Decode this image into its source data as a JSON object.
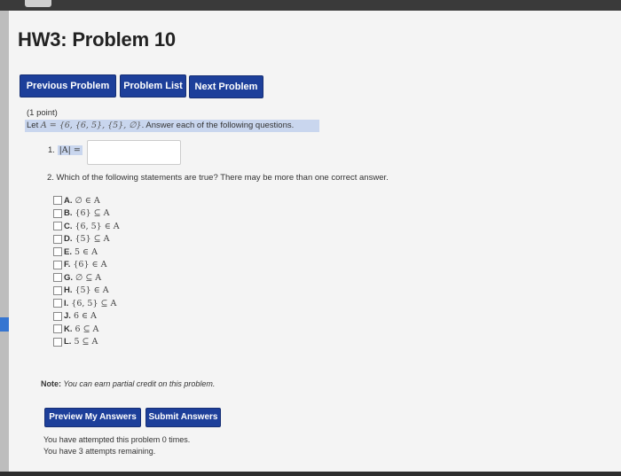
{
  "page_title": "HW3: Problem 10",
  "nav": {
    "prev": "Previous Problem",
    "list": "Problem List",
    "next": "Next Problem"
  },
  "problem": {
    "points": "(1 point)",
    "intro_prefix": "Let ",
    "intro_set": "A = {6, {6, 5}, {5}, ∅}",
    "intro_suffix": ". Answer each of the following questions."
  },
  "q1": {
    "number": "1.",
    "label": "|A| =",
    "value": ""
  },
  "q2": {
    "text": "2. Which of the following statements are true? There may be more than one correct answer."
  },
  "options": [
    {
      "letter": "A.",
      "stmt": "∅ ∈ A"
    },
    {
      "letter": "B.",
      "stmt": "{6} ⊆ A"
    },
    {
      "letter": "C.",
      "stmt": "{6, 5} ∈ A"
    },
    {
      "letter": "D.",
      "stmt": "{5} ⊆ A"
    },
    {
      "letter": "E.",
      "stmt": "5 ∈ A"
    },
    {
      "letter": "F.",
      "stmt": "{6} ∈ A"
    },
    {
      "letter": "G.",
      "stmt": "∅ ⊆ A"
    },
    {
      "letter": "H.",
      "stmt": "{5} ∈ A"
    },
    {
      "letter": "I.",
      "stmt": "{6, 5} ⊆ A"
    },
    {
      "letter": "J.",
      "stmt": "6 ∈ A"
    },
    {
      "letter": "K.",
      "stmt": "6 ⊆ A"
    },
    {
      "letter": "L.",
      "stmt": "5 ⊆ A"
    }
  ],
  "note": {
    "label": "Note:",
    "text": " You can earn partial credit on this problem."
  },
  "actions": {
    "preview": "Preview My Answers",
    "submit": "Submit Answers"
  },
  "status": {
    "attempted": "You have attempted this problem 0 times.",
    "remaining": "You have 3 attempts remaining."
  }
}
